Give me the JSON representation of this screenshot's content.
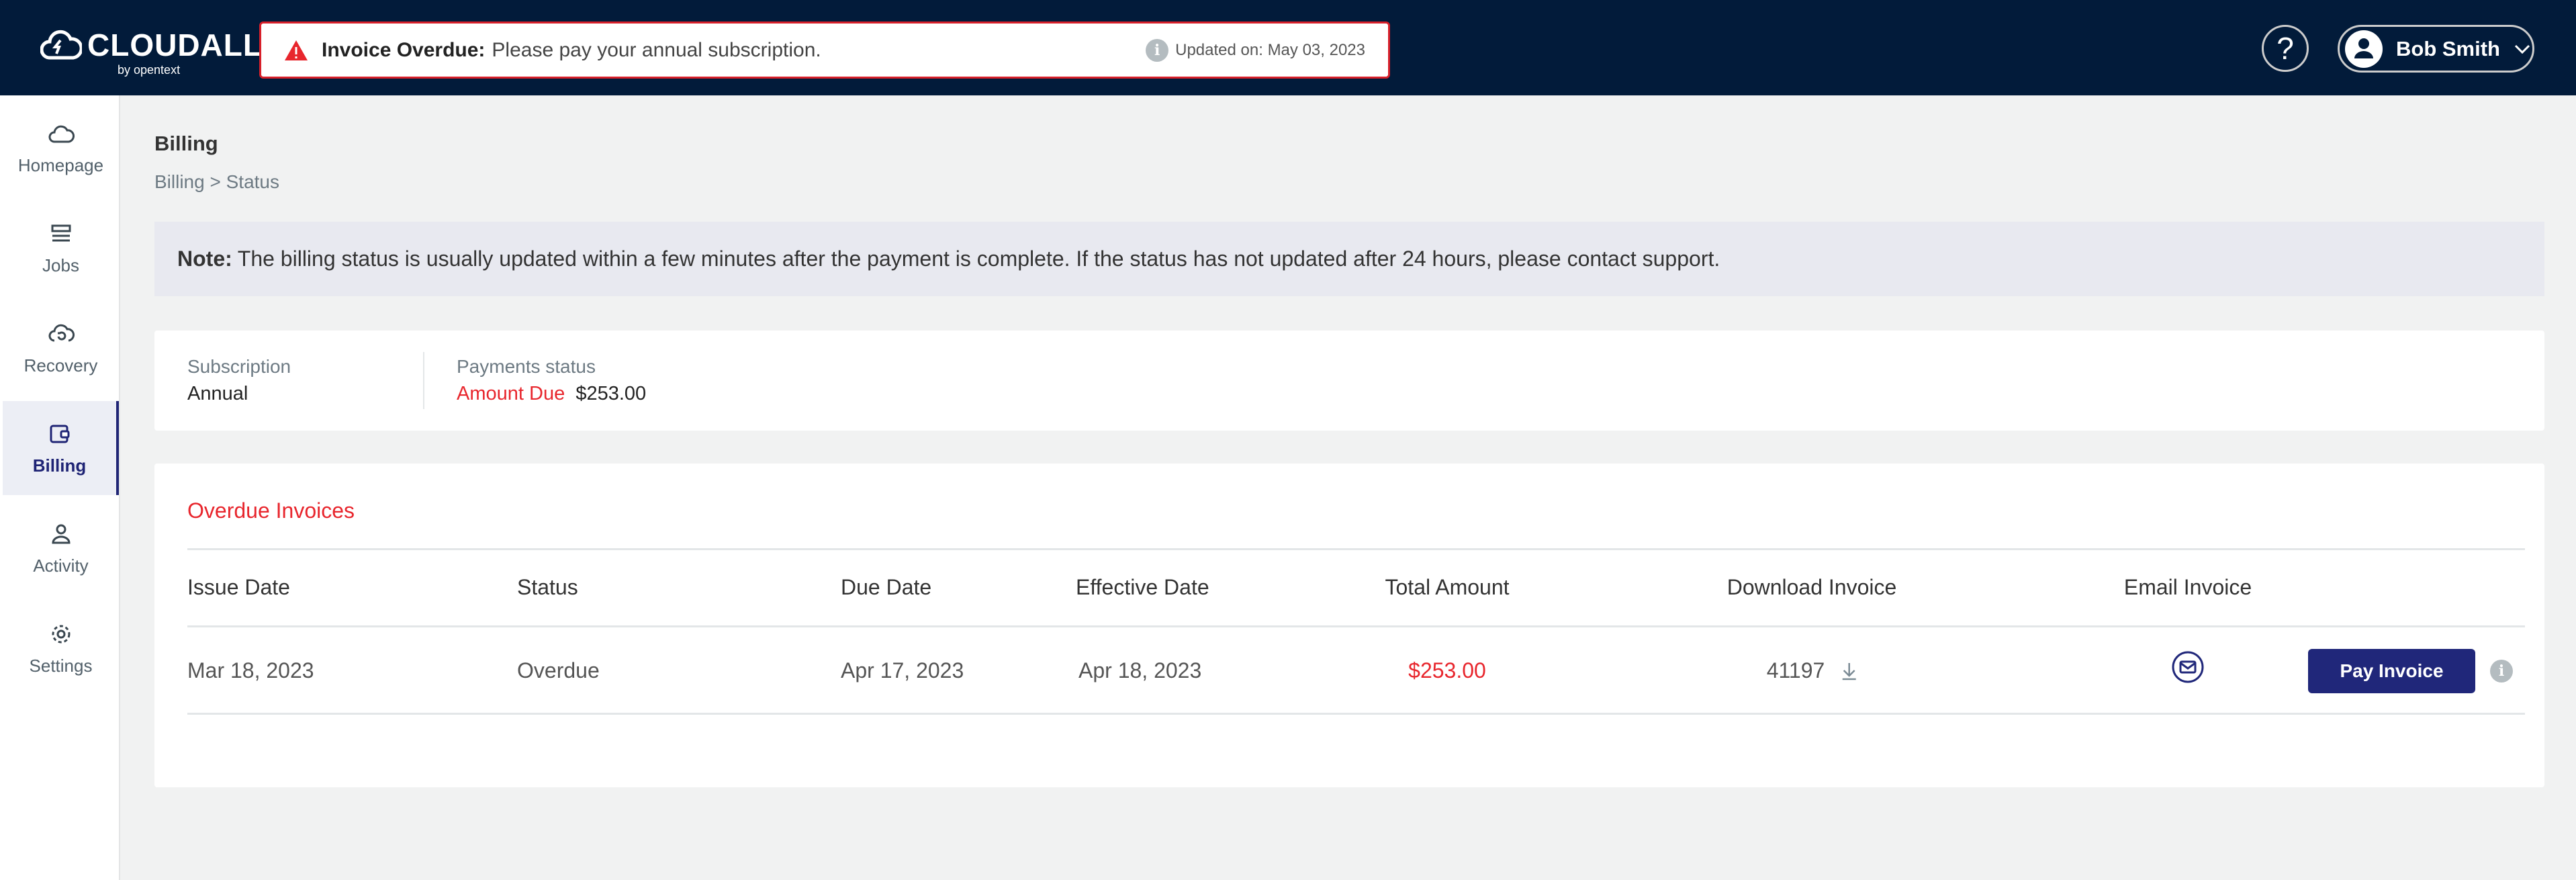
{
  "header": {
    "logo": "CLOUDALLY",
    "logo_sub": "by opentext",
    "alert": {
      "title": "Invoice Overdue:",
      "message": "Please pay your annual subscription.",
      "updated": "Updated on: May 03, 2023"
    },
    "help": "?",
    "user": "Bob Smith"
  },
  "sidebar": {
    "items": [
      {
        "label": "Homepage"
      },
      {
        "label": "Jobs"
      },
      {
        "label": "Recovery"
      },
      {
        "label": "Billing"
      },
      {
        "label": "Activity"
      },
      {
        "label": "Settings"
      }
    ]
  },
  "page": {
    "title": "Billing",
    "breadcrumb": "Billing > Status"
  },
  "note": {
    "label": "Note:",
    "text": "The billing status is usually updated within a few minutes after the payment is complete. If the status has not updated after 24 hours, please contact support."
  },
  "subscription": {
    "label": "Subscription",
    "value": "Annual",
    "payments_label": "Payments status",
    "status": "Amount Due",
    "amount": "$253.00"
  },
  "invoices": {
    "title": "Overdue Invoices",
    "columns": [
      "Issue Date",
      "Status",
      "Due Date",
      "Effective Date",
      "Total Amount",
      "Download Invoice",
      "Email Invoice"
    ],
    "rows": [
      {
        "issue": "Mar 18, 2023",
        "status": "Overdue",
        "due": "Apr 17, 2023",
        "effective": "Apr 18, 2023",
        "total": "$253.00",
        "invoice": "41197",
        "pay": "Pay Invoice"
      }
    ]
  },
  "colors": {
    "header": "#021b3a",
    "accent": "#20277a",
    "danger": "#e8262d"
  }
}
